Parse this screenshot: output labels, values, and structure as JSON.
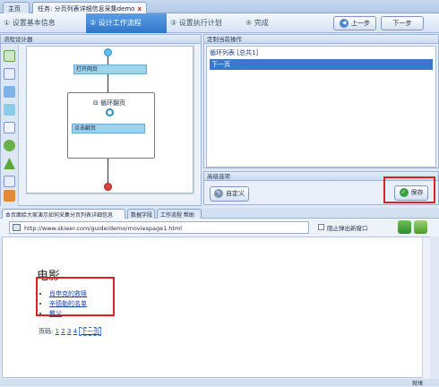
{
  "tabs": [
    {
      "label": "主页"
    },
    {
      "label": "任务: 分页列表详细信息采集demo"
    }
  ],
  "tab_close_glyph": "x",
  "wizard": {
    "steps": [
      "设置基本信息",
      "设计工作流程",
      "设置执行计划",
      "完成"
    ],
    "step_numbers": [
      "①",
      "②",
      "③",
      "④"
    ],
    "prev_label": "上一步",
    "next_label": "下一步"
  },
  "designer": {
    "title": "流程设计器",
    "nodes": {
      "open_page": "打开网页",
      "loop": "循环翻页",
      "click": "点击翻页"
    },
    "loop_toggle": "⊟"
  },
  "config": {
    "title": "定制当前操作",
    "list_item": "循环列表 [总共1]",
    "selected_item": "下一页"
  },
  "advanced": {
    "title": "高级选项",
    "custom_label": "自定义",
    "save_label": "保存"
  },
  "browser": {
    "tabs": [
      "本页面给大家演示如何采集分页列表详细信息",
      "数据字段",
      "工作流程 帮助"
    ],
    "url": "http://www.skieer.com/guide/demo/moviespage1.html",
    "popup_label": "阻止弹出新窗口"
  },
  "page": {
    "heading": "电影",
    "movies": [
      "肖申克的救赎",
      "辛德勒的名单",
      "教父"
    ],
    "pager_label": "页码:",
    "pager_links": [
      "1",
      "2",
      "3",
      "4"
    ],
    "next_link": "下一页"
  },
  "status": {
    "label": "就绪"
  },
  "colors": {
    "highlight": "#e02020",
    "accent": "#2f74c8",
    "node": "#9ed3ee"
  }
}
